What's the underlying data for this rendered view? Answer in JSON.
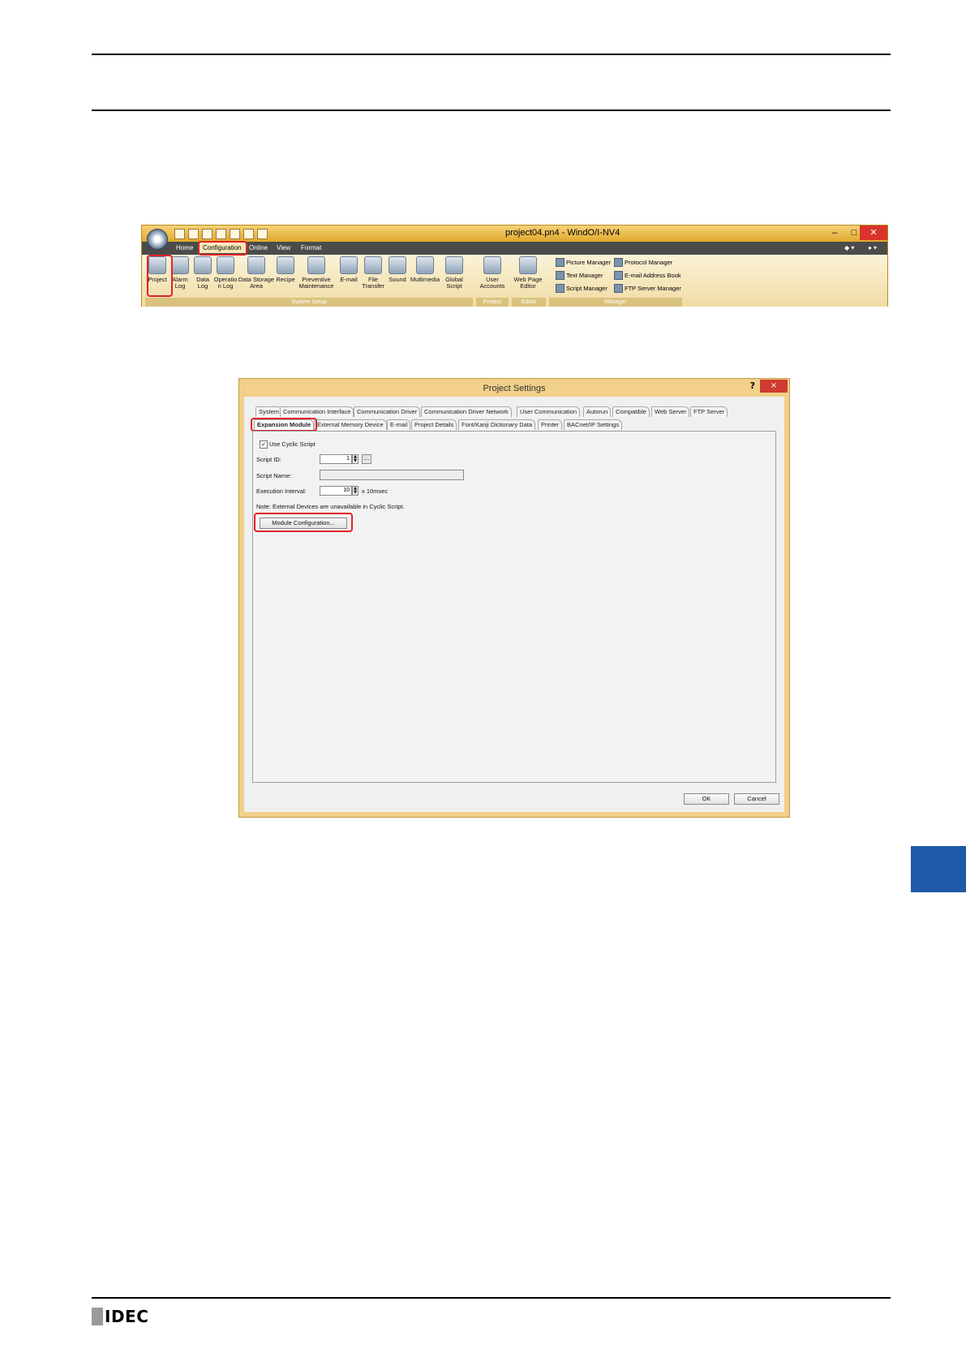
{
  "ribbon": {
    "title": "project04.pn4 - WindO/I-NV4",
    "tabs": [
      "Home",
      "Configuration",
      "Online",
      "View",
      "Format"
    ],
    "buttons": [
      {
        "label": "Project"
      },
      {
        "label": "Alarm Log"
      },
      {
        "label": "Data Log"
      },
      {
        "label": "Operatio n Log"
      },
      {
        "label": "Data Storage Area"
      },
      {
        "label": "Recipe"
      },
      {
        "label": "Preventive Maintenance"
      },
      {
        "label": "E-mail"
      },
      {
        "label": "File Transfer"
      },
      {
        "label": "Sound"
      },
      {
        "label": "Multimedia"
      },
      {
        "label": "Global Script"
      },
      {
        "label": "User Accounts"
      },
      {
        "label": "Web Page Editor"
      }
    ],
    "managers": [
      "Picture Manager",
      "Protocol Manager",
      "Text Manager",
      "E-mail Address Book",
      "Script Manager",
      "FTP Server Manager"
    ],
    "groups": [
      "System Setup",
      "Protect",
      "Editor",
      "Manager"
    ]
  },
  "dialog": {
    "title": "Project Settings",
    "help": "?",
    "close": "×",
    "tabs_row1": [
      "System",
      "Communication Interface",
      "Communication Driver",
      "Communication Driver Network",
      "User Communication",
      "Autorun",
      "Compatible",
      "Web Server",
      "FTP Server"
    ],
    "tabs_row2": [
      "Expansion Module",
      "External Memory Device",
      "E-mail",
      "Project Details",
      "Font/Kanji Dictionary Data",
      "Printer",
      "BACnet/IP Settings"
    ],
    "use_cyclic_script": "Use Cyclic Script",
    "script_id_label": "Script ID:",
    "script_id_value": "1",
    "browse": "...",
    "script_name_label": "Script Name:",
    "exec_interval_label": "Execution Interval:",
    "exec_interval_value": "10",
    "exec_interval_unit": "x 10msec",
    "note": "Note: External Devices are unavailable in Cyclic Script.",
    "module_config_button": "Module Configuration...",
    "ok": "OK",
    "cancel": "Cancel"
  },
  "footer": {
    "logo": "IDEC"
  },
  "colors": {
    "side_tab": "#1e5aa8",
    "highlight": "#e0222a"
  }
}
